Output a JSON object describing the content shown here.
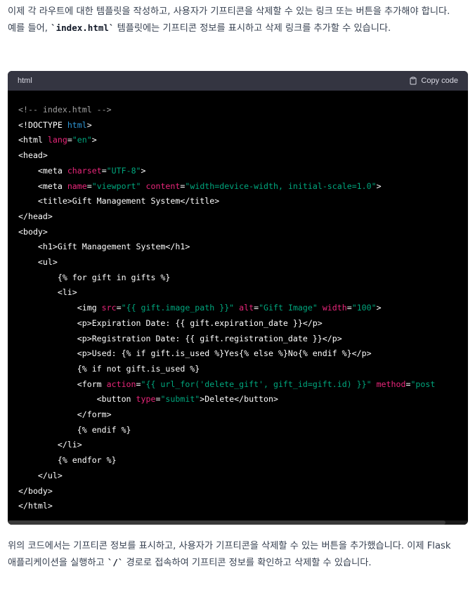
{
  "intro": {
    "text_before": "이제 각 라우트에 대한 템플릿을 작성하고, 사용자가 기프티콘을 삭제할 수 있는 링크 또는 버튼을 추가해야 합니다. 예를 들어, ",
    "code": "`index.html`",
    "text_after": " 템플릿에는 기프티콘 정보를 표시하고 삭제 링크를 추가할 수 있습니다."
  },
  "code_block": {
    "language": "html",
    "copy_label": "Copy code",
    "lines": [
      [
        {
          "t": "<!-- index.html -->",
          "c": "comment"
        }
      ],
      [
        {
          "t": "<!DOCTYPE ",
          "c": "plain"
        },
        {
          "t": "html",
          "c": "kw"
        },
        {
          "t": ">",
          "c": "plain"
        }
      ],
      [
        {
          "t": "<html ",
          "c": "plain"
        },
        {
          "t": "lang",
          "c": "attr"
        },
        {
          "t": "=",
          "c": "plain"
        },
        {
          "t": "\"en\"",
          "c": "str"
        },
        {
          "t": ">",
          "c": "plain"
        }
      ],
      [
        {
          "t": "<head>",
          "c": "plain"
        }
      ],
      [
        {
          "t": "    <meta ",
          "c": "plain"
        },
        {
          "t": "charset",
          "c": "attr"
        },
        {
          "t": "=",
          "c": "plain"
        },
        {
          "t": "\"UTF-8\"",
          "c": "str"
        },
        {
          "t": ">",
          "c": "plain"
        }
      ],
      [
        {
          "t": "    <meta ",
          "c": "plain"
        },
        {
          "t": "name",
          "c": "attr"
        },
        {
          "t": "=",
          "c": "plain"
        },
        {
          "t": "\"viewport\"",
          "c": "str"
        },
        {
          "t": " ",
          "c": "plain"
        },
        {
          "t": "content",
          "c": "attr"
        },
        {
          "t": "=",
          "c": "plain"
        },
        {
          "t": "\"width=device-width, initial-scale=1.0\"",
          "c": "str"
        },
        {
          "t": ">",
          "c": "plain"
        }
      ],
      [
        {
          "t": "    <title>Gift Management System</title>",
          "c": "plain"
        }
      ],
      [
        {
          "t": "</head>",
          "c": "plain"
        }
      ],
      [
        {
          "t": "<body>",
          "c": "plain"
        }
      ],
      [
        {
          "t": "    <h1>Gift Management System</h1>",
          "c": "plain"
        }
      ],
      [
        {
          "t": "    <ul>",
          "c": "plain"
        }
      ],
      [
        {
          "t": "        {% for gift in gifts %}",
          "c": "plain"
        }
      ],
      [
        {
          "t": "        <li>",
          "c": "plain"
        }
      ],
      [
        {
          "t": "            <img ",
          "c": "plain"
        },
        {
          "t": "src",
          "c": "attr"
        },
        {
          "t": "=",
          "c": "plain"
        },
        {
          "t": "\"{{ gift.image_path }}\"",
          "c": "str"
        },
        {
          "t": " ",
          "c": "plain"
        },
        {
          "t": "alt",
          "c": "attr"
        },
        {
          "t": "=",
          "c": "plain"
        },
        {
          "t": "\"Gift Image\"",
          "c": "str"
        },
        {
          "t": " ",
          "c": "plain"
        },
        {
          "t": "width",
          "c": "attr"
        },
        {
          "t": "=",
          "c": "plain"
        },
        {
          "t": "\"100\"",
          "c": "str"
        },
        {
          "t": ">",
          "c": "plain"
        }
      ],
      [
        {
          "t": "            <p>Expiration Date: {{ gift.expiration_date }}</p>",
          "c": "plain"
        }
      ],
      [
        {
          "t": "            <p>Registration Date: {{ gift.registration_date }}</p>",
          "c": "plain"
        }
      ],
      [
        {
          "t": "            <p>Used: {% if gift.is_used %}Yes{% else %}No{% endif %}</p>",
          "c": "plain"
        }
      ],
      [
        {
          "t": "            {% if not gift.is_used %}",
          "c": "plain"
        }
      ],
      [
        {
          "t": "            <form ",
          "c": "plain"
        },
        {
          "t": "action",
          "c": "attr"
        },
        {
          "t": "=",
          "c": "plain"
        },
        {
          "t": "\"{{ url_for('delete_gift', gift_id=gift.id) }}\"",
          "c": "str"
        },
        {
          "t": " ",
          "c": "plain"
        },
        {
          "t": "method",
          "c": "attr"
        },
        {
          "t": "=",
          "c": "plain"
        },
        {
          "t": "\"post",
          "c": "str"
        }
      ],
      [
        {
          "t": "                <button ",
          "c": "plain"
        },
        {
          "t": "type",
          "c": "attr"
        },
        {
          "t": "=",
          "c": "plain"
        },
        {
          "t": "\"submit\"",
          "c": "str"
        },
        {
          "t": ">Delete</button>",
          "c": "plain"
        }
      ],
      [
        {
          "t": "            </form>",
          "c": "plain"
        }
      ],
      [
        {
          "t": "            {% endif %}",
          "c": "plain"
        }
      ],
      [
        {
          "t": "        </li>",
          "c": "plain"
        }
      ],
      [
        {
          "t": "        {% endfor %}",
          "c": "plain"
        }
      ],
      [
        {
          "t": "    </ul>",
          "c": "plain"
        }
      ],
      [
        {
          "t": "</body>",
          "c": "plain"
        }
      ],
      [
        {
          "t": "</html>",
          "c": "plain"
        }
      ]
    ]
  },
  "outro": {
    "text_before": "위의 코드에서는 기프티콘 정보를 표시하고, 사용자가 기프티콘을 삭제할 수 있는 버튼을 추가했습니다. 이제 Flask 애플리케이션을 실행하고 ",
    "code": "`/`",
    "text_after": " 경로로 접속하여 기프티콘 정보를 확인하고 삭제할 수 있습니다."
  },
  "colors": {
    "header_bg": "#343541",
    "code_bg": "#000000",
    "comment": "#a0a0a0",
    "attr": "#e9267a",
    "string": "#00a67d",
    "keyword": "#2e95d3"
  },
  "icons": {
    "copy": "clipboard-icon"
  }
}
